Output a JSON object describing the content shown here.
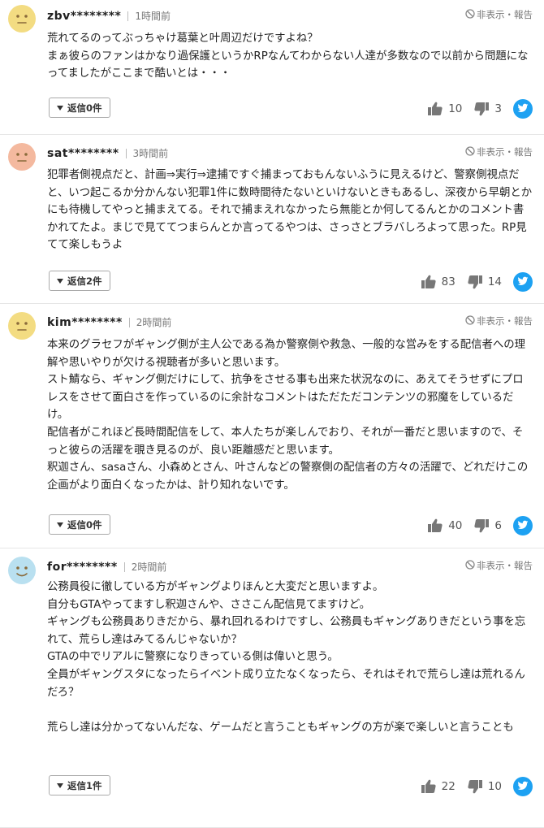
{
  "report_label": "非表示・報告",
  "comments": [
    {
      "user": "zbv********",
      "time": "1時間前",
      "avatar_color": "#f3dc82",
      "avatar_face": "neutral",
      "text": "荒れてるのってぶっちゃけ葛葉と叶周辺だけですよね？\nまぁ彼らのファンはかなり過保護というかRPなんてわからない人達が多数なので以前から問題になってましたがここまで酷いとは・・・",
      "reply_label": "返信0件",
      "likes": "10",
      "dislikes": "3"
    },
    {
      "user": "sat********",
      "time": "3時間前",
      "avatar_color": "#f4b99f",
      "avatar_face": "neutral",
      "text": "犯罪者側視点だと、計画⇒実行⇒逮捕ですぐ捕まっておもんないふうに見えるけど、警察側視点だと、いつ起こるか分かんない犯罪1件に数時間待たないといけないときもあるし、深夜から早朝とかにも待機してやっと捕まえてる。それで捕まえれなかったら無能とか何してるんとかのコメント書かれてたよ。まじで見ててつまらんとか言ってるやつは、さっさとブラバしろよって思った。RP見てて楽しもうよ",
      "reply_label": "返信2件",
      "likes": "83",
      "dislikes": "14"
    },
    {
      "user": "kim********",
      "time": "2時間前",
      "avatar_color": "#f3dc82",
      "avatar_face": "neutral",
      "text": "本来のグラセフがギャング側が主人公である為か警察側や救急、一般的な営みをする配信者への理解や思いやりが欠ける視聴者が多いと思います。\nスト鯖なら、ギャング側だけにして、抗争をさせる事も出来た状況なのに、あえてそうせずにプロレスをさせて面白さを作っているのに余計なコメントはただただコンテンツの邪魔をしているだけ。\n配信者がこれほど長時間配信をして、本人たちが楽しんでおり、それが一番だと思いますので、そっと彼らの活躍を覗き見るのが、良い距離感だと思います。\n釈迦さん、sasaさん、小森めとさん、叶さんなどの警察側の配信者の方々の活躍で、どれだけこの企画がより面白くなったかは、計り知れないです。",
      "reply_label": "返信0件",
      "likes": "40",
      "dislikes": "6"
    },
    {
      "user": "for********",
      "time": "2時間前",
      "avatar_color": "#b9e0f0",
      "avatar_face": "smile",
      "text": "公務員役に徹している方がギャングよりほんと大変だと思いますよ。\n自分もGTAやってますし釈迦さんや、ささこん配信見てますけど。\nギャングも公務員ありきだから、暴れ回れるわけですし、公務員もギャングありきだという事を忘れて、荒らし達はみてるんじゃないか？\nGTAの中でリアルに警察になりきっている側は偉いと思う。\n全員がギャングスタになったらイベント成り立たなくなったら、それはそれで荒らし達は荒れるんだろ？\n\n荒らし達は分かってないんだな、ゲームだと言うこともギャングの方が楽で楽しいと言うことも",
      "reply_label": "返信1件",
      "likes": "22",
      "dislikes": "10"
    }
  ]
}
